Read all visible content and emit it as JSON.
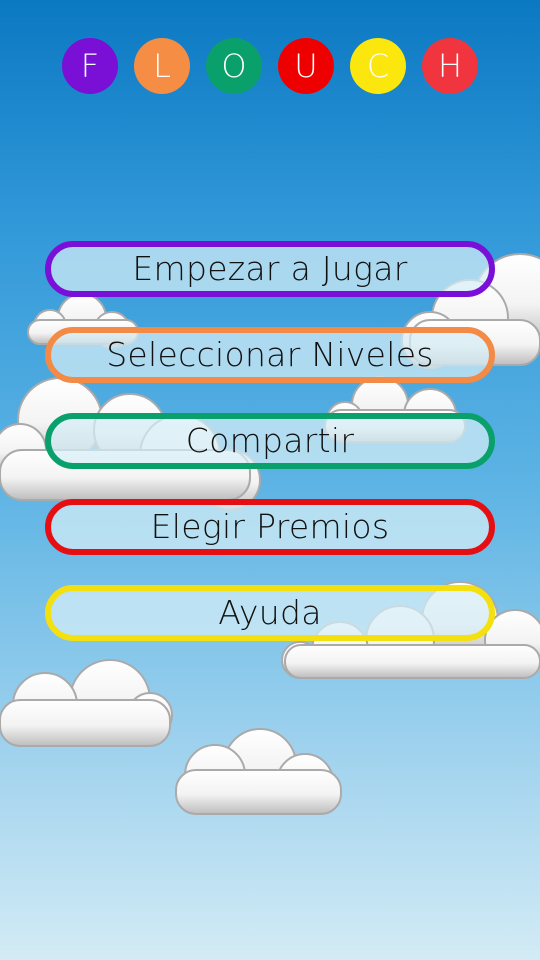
{
  "logo": {
    "letters": [
      {
        "char": "F",
        "color": "#7a0fd6"
      },
      {
        "char": "L",
        "color": "#f58d44"
      },
      {
        "char": "O",
        "color": "#0aa06c"
      },
      {
        "char": "U",
        "color": "#ef0000"
      },
      {
        "char": "C",
        "color": "#fbe60e"
      },
      {
        "char": "H",
        "color": "#f0353f"
      }
    ]
  },
  "menu": {
    "items": [
      {
        "label": "Empezar a Jugar",
        "border_color": "#7a10d8"
      },
      {
        "label": "Seleccionar Niveles",
        "border_color": "#f38a45"
      },
      {
        "label": "Compartir",
        "border_color": "#0aa06c"
      },
      {
        "label": "Elegir Premios",
        "border_color": "#e50f13"
      },
      {
        "label": "Ayuda",
        "border_color": "#f4e00f"
      }
    ]
  },
  "background": {
    "sky_top": "#0b78c2",
    "sky_bottom": "#d3ebf5",
    "cloud_color": "#ffffff",
    "cloud_shadow": "#c8c8c8"
  }
}
